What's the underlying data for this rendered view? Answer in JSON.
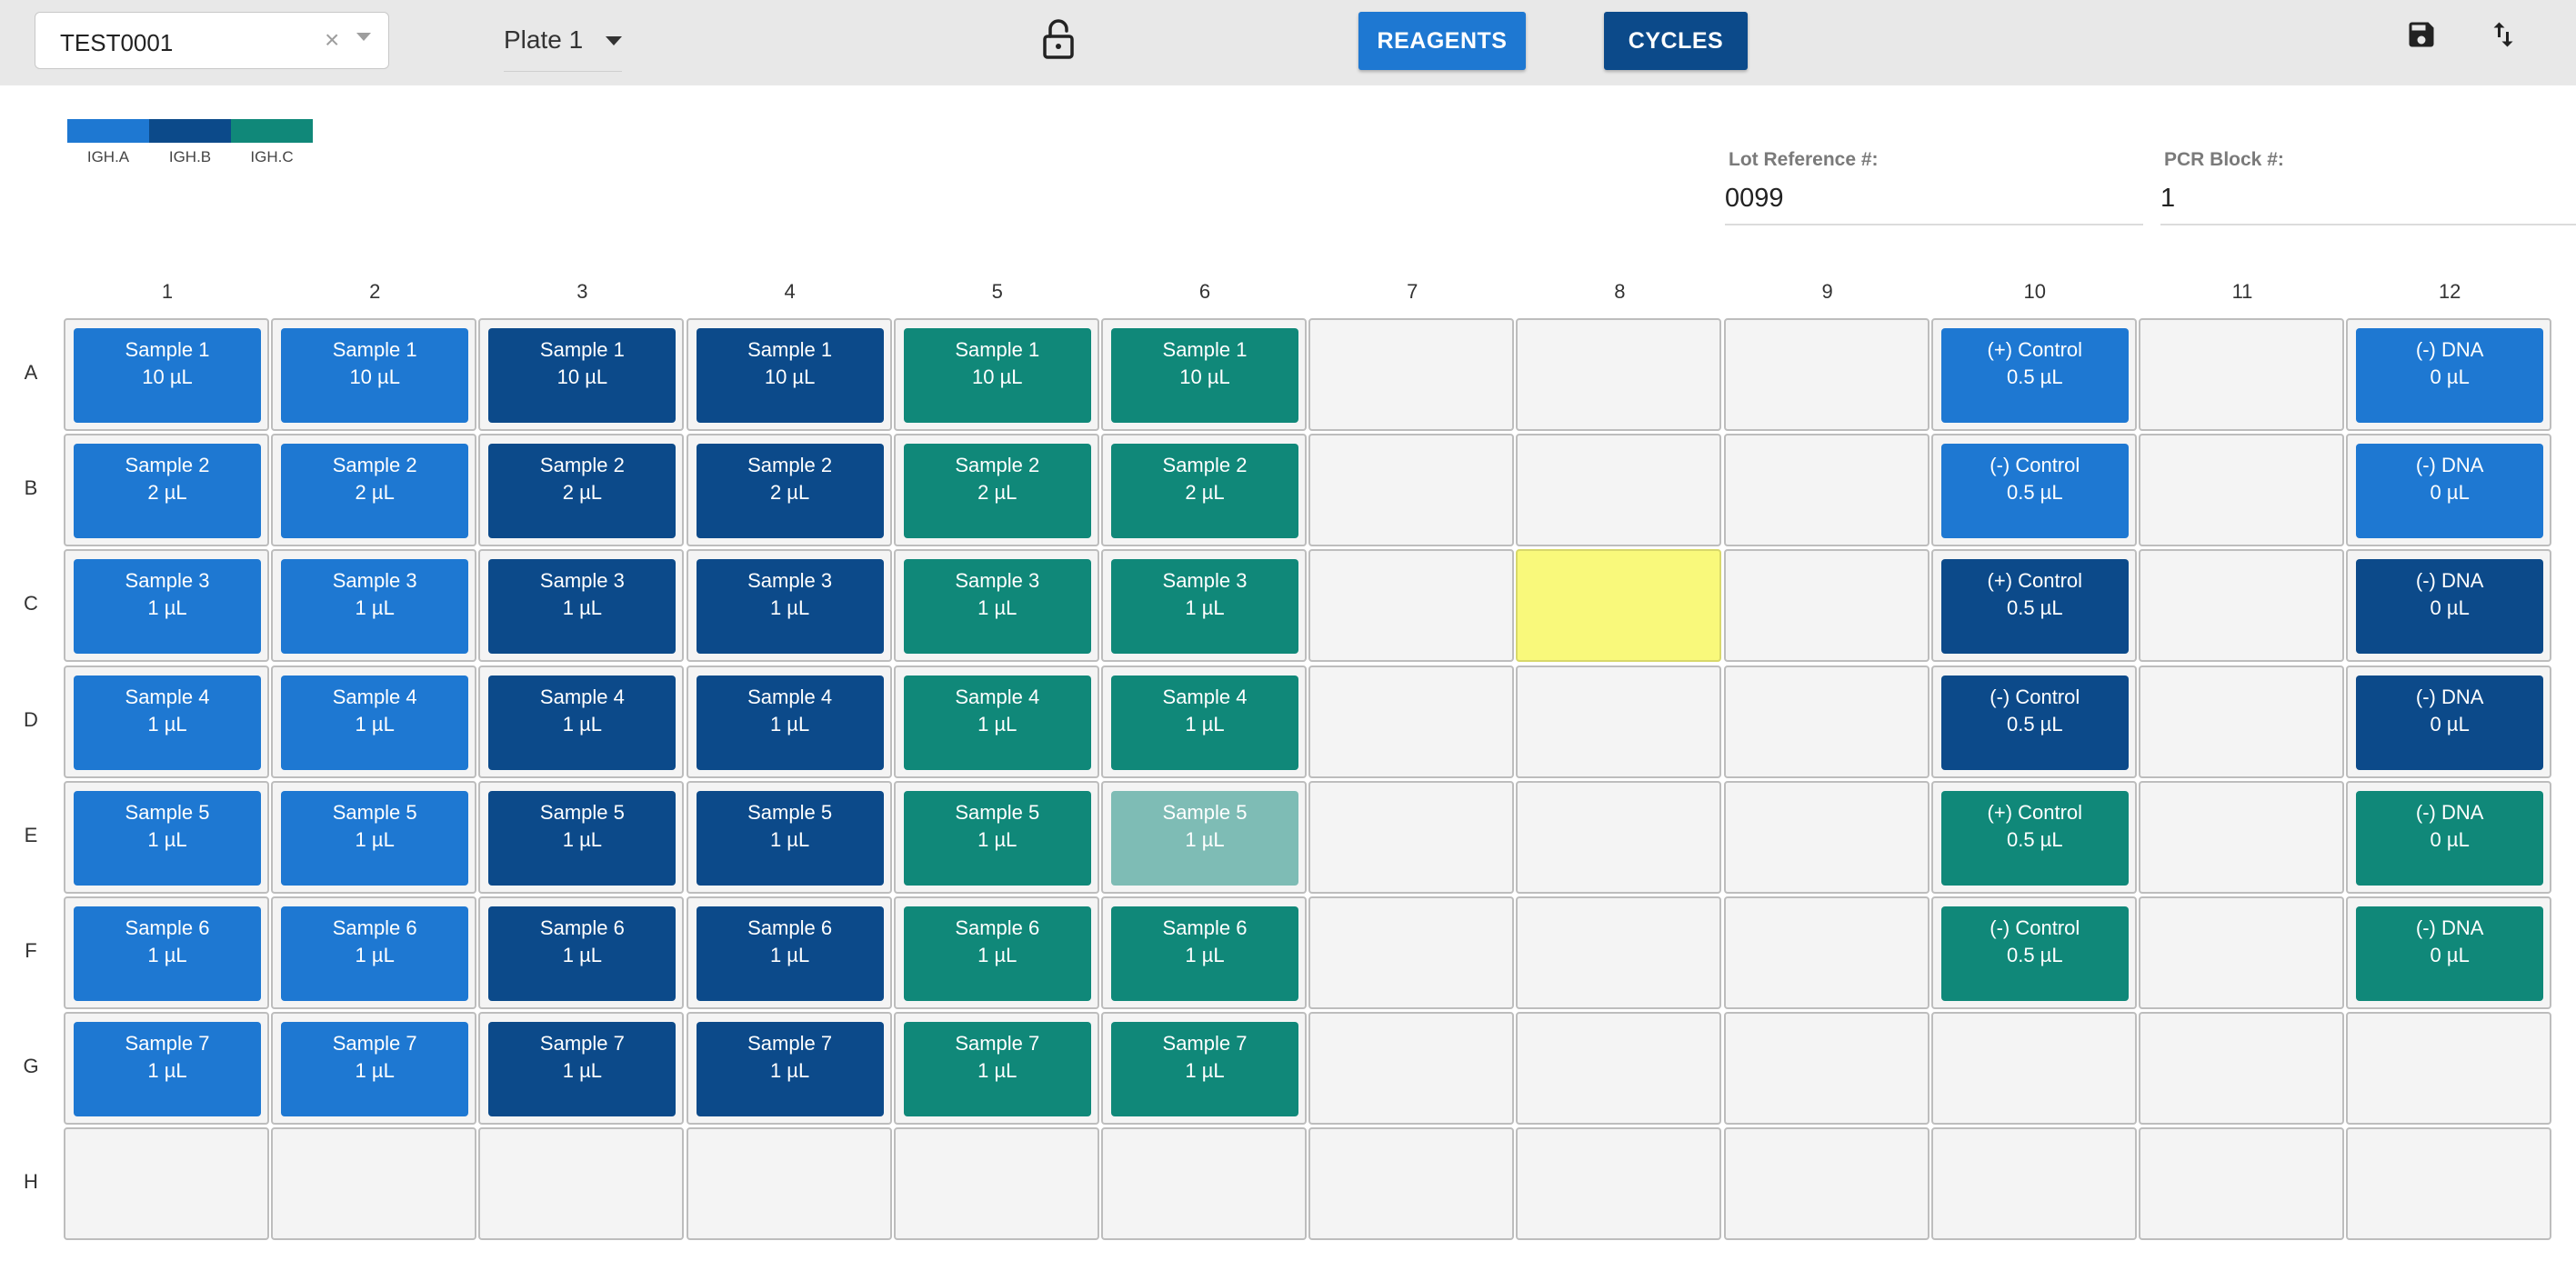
{
  "toolbar": {
    "test_id": "TEST0001",
    "plate": "Plate 1",
    "reagents_label": "REAGENTS",
    "cycles_label": "CYCLES"
  },
  "colors": {
    "IGH.A": "#1e78d2",
    "IGH.B": "#0c4a8a",
    "IGH.C": "#108879",
    "IGH.C.faded": "#7ebcb5",
    "highlight": "#f9f97b"
  },
  "legend": [
    {
      "label": "IGH.A",
      "color": "#1e78d2"
    },
    {
      "label": "IGH.B",
      "color": "#0c4a8a"
    },
    {
      "label": "IGH.C",
      "color": "#108879"
    }
  ],
  "fields": {
    "lot_label": "Lot Reference #:",
    "lot_value": "0099",
    "pcr_label": "PCR Block #:",
    "pcr_value": "1"
  },
  "plate": {
    "columns": [
      "1",
      "2",
      "3",
      "4",
      "5",
      "6",
      "7",
      "8",
      "9",
      "10",
      "11",
      "12"
    ],
    "rows": [
      "A",
      "B",
      "C",
      "D",
      "E",
      "F",
      "G",
      "H"
    ],
    "wells": [
      [
        "IGH.A|Sample 1|10 µL",
        "IGH.A|Sample 1|10 µL",
        "IGH.B|Sample 1|10 µL",
        "IGH.B|Sample 1|10 µL",
        "IGH.C|Sample 1|10 µL",
        "IGH.C|Sample 1|10 µL",
        "",
        "",
        "",
        "IGH.A|(+) Control|0.5 µL",
        "",
        "IGH.A|(-) DNA|0 µL"
      ],
      [
        "IGH.A|Sample 2|2 µL",
        "IGH.A|Sample 2|2 µL",
        "IGH.B|Sample 2|2 µL",
        "IGH.B|Sample 2|2 µL",
        "IGH.C|Sample 2|2 µL",
        "IGH.C|Sample 2|2 µL",
        "",
        "",
        "",
        "IGH.A|(-) Control|0.5 µL",
        "",
        "IGH.A|(-) DNA|0 µL"
      ],
      [
        "IGH.A|Sample 3|1 µL",
        "IGH.A|Sample 3|1 µL",
        "IGH.B|Sample 3|1 µL",
        "IGH.B|Sample 3|1 µL",
        "IGH.C|Sample 3|1 µL",
        "IGH.C|Sample 3|1 µL",
        "",
        "highlight",
        "",
        "IGH.B|(+) Control|0.5 µL",
        "",
        "IGH.B|(-) DNA|0 µL"
      ],
      [
        "IGH.A|Sample 4|1 µL",
        "IGH.A|Sample 4|1 µL",
        "IGH.B|Sample 4|1 µL",
        "IGH.B|Sample 4|1 µL",
        "IGH.C|Sample 4|1 µL",
        "IGH.C|Sample 4|1 µL",
        "",
        "",
        "",
        "IGH.B|(-) Control|0.5 µL",
        "",
        "IGH.B|(-) DNA|0 µL"
      ],
      [
        "IGH.A|Sample 5|1 µL",
        "IGH.A|Sample 5|1 µL",
        "IGH.B|Sample 5|1 µL",
        "IGH.B|Sample 5|1 µL",
        "IGH.C|Sample 5|1 µL",
        "IGH.C.faded|Sample 5|1 µL",
        "",
        "",
        "",
        "IGH.C|(+) Control|0.5 µL",
        "",
        "IGH.C|(-) DNA|0 µL"
      ],
      [
        "IGH.A|Sample 6|1 µL",
        "IGH.A|Sample 6|1 µL",
        "IGH.B|Sample 6|1 µL",
        "IGH.B|Sample 6|1 µL",
        "IGH.C|Sample 6|1 µL",
        "IGH.C|Sample 6|1 µL",
        "",
        "",
        "",
        "IGH.C|(-) Control|0.5 µL",
        "",
        "IGH.C|(-) DNA|0 µL"
      ],
      [
        "IGH.A|Sample 7|1 µL",
        "IGH.A|Sample 7|1 µL",
        "IGH.B|Sample 7|1 µL",
        "IGH.B|Sample 7|1 µL",
        "IGH.C|Sample 7|1 µL",
        "IGH.C|Sample 7|1 µL",
        "",
        "",
        "",
        "",
        "",
        ""
      ],
      [
        "",
        "",
        "",
        "",
        "",
        "",
        "",
        "",
        "",
        "",
        "",
        ""
      ]
    ]
  }
}
